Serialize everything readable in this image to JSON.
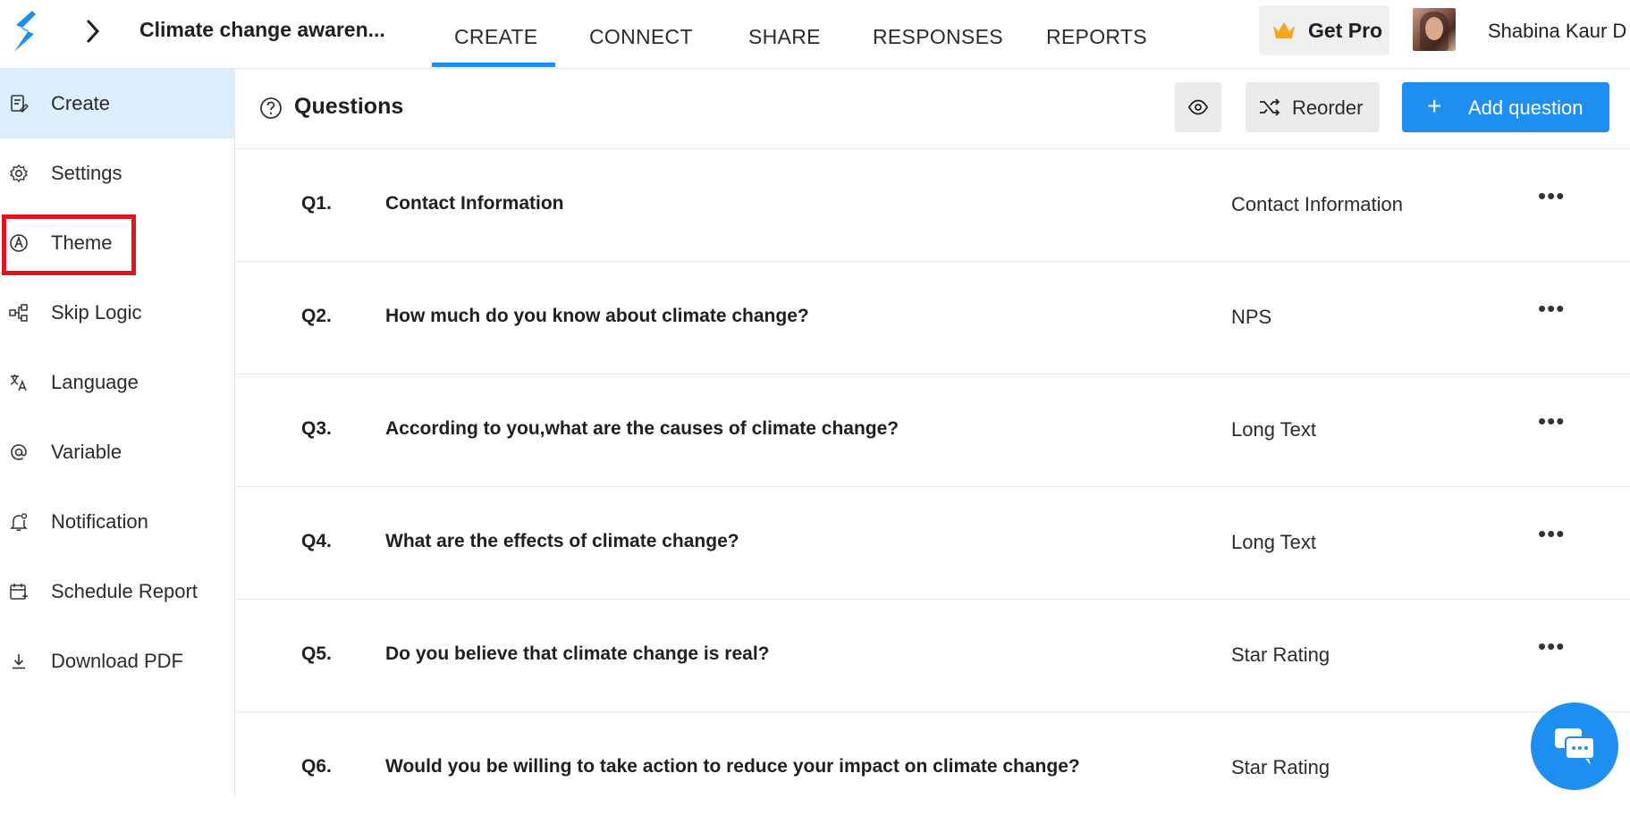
{
  "header": {
    "survey_title": "Climate change awaren...",
    "tabs": [
      "CREATE",
      "CONNECT",
      "SHARE",
      "RESPONSES",
      "REPORTS"
    ],
    "active_tab": "CREATE",
    "get_pro_label": "Get Pro",
    "user_name": "Shabina Kaur D"
  },
  "sidebar": {
    "items": [
      {
        "label": "Create",
        "icon": "create-icon",
        "active": true
      },
      {
        "label": "Settings",
        "icon": "gear-icon",
        "active": false
      },
      {
        "label": "Theme",
        "icon": "theme-icon",
        "active": false
      },
      {
        "label": "Skip Logic",
        "icon": "skip-logic-icon",
        "active": false
      },
      {
        "label": "Language",
        "icon": "translate-icon",
        "active": false
      },
      {
        "label": "Variable",
        "icon": "at-icon",
        "active": false
      },
      {
        "label": "Notification",
        "icon": "bell-icon",
        "active": false
      },
      {
        "label": "Schedule Report",
        "icon": "calendar-icon",
        "active": false
      },
      {
        "label": "Download PDF",
        "icon": "download-icon",
        "active": false
      }
    ],
    "highlighted_item": "Theme"
  },
  "main": {
    "title": "Questions",
    "reorder_label": "Reorder",
    "add_question_label": "Add question",
    "questions": [
      {
        "num": "Q1.",
        "text": "Contact Information",
        "type": "Contact Information"
      },
      {
        "num": "Q2.",
        "text": "How much do you know about climate change?",
        "type": "NPS"
      },
      {
        "num": "Q3.",
        "text": "According to you,what are the causes of climate change?",
        "type": "Long Text"
      },
      {
        "num": "Q4.",
        "text": "What are the effects of climate change?",
        "type": "Long Text"
      },
      {
        "num": "Q5.",
        "text": "Do you believe that climate change is real?",
        "type": "Star Rating"
      },
      {
        "num": "Q6.",
        "text": "Would you be willing to take action to reduce your impact on climate change?",
        "type": "Star Rating"
      }
    ]
  },
  "colors": {
    "accent": "#1f8ef1",
    "active_sidebar_bg": "#dceeff",
    "highlight": "#e0141e",
    "crown": "#f5a623"
  }
}
